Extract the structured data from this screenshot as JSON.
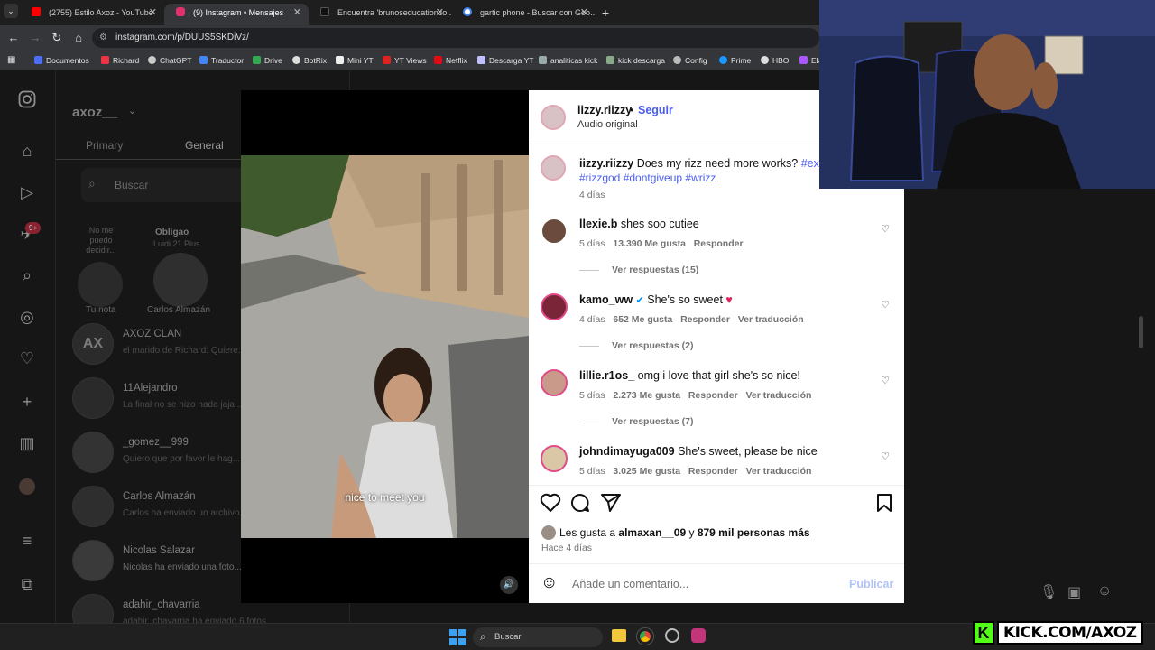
{
  "browser": {
    "tabs": [
      {
        "label": "(2755) Estilo Axoz - YouTube",
        "favicon_color": "#ff0000"
      },
      {
        "label": "(9) Instagram • Mensajes",
        "favicon_color": "#e1306c"
      },
      {
        "label": "Encuentra 'brunoseducationco...",
        "favicon_color": "#111111"
      },
      {
        "label": "gartic phone - Buscar con Goo...",
        "favicon_color": "#4285f4"
      }
    ],
    "url": "instagram.com/p/DUUS5SKDiVz/",
    "bookmarks": [
      "Documentos",
      "Richard",
      "ChatGPT",
      "Traductor",
      "Drive",
      "BotRix",
      "Mini YT",
      "YT Views",
      "Netflix",
      "Descarga YT",
      "analiticas kick",
      "kick descarga",
      "Config",
      "Prime",
      "HBO",
      "Ek"
    ]
  },
  "instagram": {
    "account_name": "axoz__",
    "dm_tabs": [
      "Primary",
      "General"
    ],
    "search_placeholder": "Buscar",
    "notes": [
      {
        "text": "No me puedo decidir...",
        "label": "Tu nota"
      },
      {
        "text": "Obligao",
        "sub": "Luidi 21 Plus",
        "label": "Carlos Almazán"
      }
    ],
    "notification_badge": "9+",
    "conversations": [
      {
        "name": "AXOZ CLAN",
        "snippet": "el marido de Richard: Quiere..."
      },
      {
        "name": "11Alejandro",
        "snippet": "La final no se hizo nada jaja..."
      },
      {
        "name": "_gomez__999",
        "snippet": "Quiero que por favor le hag..."
      },
      {
        "name": "Carlos Almazán",
        "snippet": "Carlos ha enviado un archivo..."
      },
      {
        "name": "Nicolas Salazar",
        "snippet": "Nicolas ha enviado una foto..."
      },
      {
        "name": "adahir_chavarria",
        "snippet": "adahir_chavarria ha enviado 6 fotos"
      }
    ]
  },
  "post": {
    "author": "iizzy.riizzy",
    "follow_label": "Seguir",
    "audio": "Audio original",
    "subtitle": "nice to meet you",
    "caption_user": "iizzy.riizzy",
    "caption_text": "Does my rizz need more works?",
    "caption_tags_line1": "#explor",
    "caption_tags_line2": "#rizzgod #dontgiveup #wrizz",
    "caption_age": "4 días",
    "comments": [
      {
        "user": "llexie.b",
        "text": "shes soo cutiee",
        "age": "5 días",
        "likes": "13.390 Me gusta",
        "reply": "Responder",
        "translate": "",
        "replies": "Ver respuestas (15)"
      },
      {
        "user": "kamo_ww",
        "text": "She's so sweet",
        "age": "4 días",
        "likes": "652 Me gusta",
        "reply": "Responder",
        "translate": "Ver traducción",
        "replies": "Ver respuestas (2)"
      },
      {
        "user": "lillie.r1os_",
        "text": "omg i love that girl she's so nice!",
        "age": "5 días",
        "likes": "2.273 Me gusta",
        "reply": "Responder",
        "translate": "Ver traducción",
        "replies": "Ver respuestas (7)"
      },
      {
        "user": "johndimayuga009",
        "text": "She's sweet, please be nice",
        "age": "5 días",
        "likes": "3.025 Me gusta",
        "reply": "Responder",
        "translate": "Ver traducción",
        "replies": ""
      }
    ],
    "likes_prefix": "Les gusta a",
    "likes_user": "almaxan__09",
    "likes_and": "y",
    "likes_rest": "879 mil personas más",
    "posted": "Hace 4 días",
    "comment_placeholder": "Añade un comentario...",
    "publish_label": "Publicar"
  },
  "taskbar": {
    "search_placeholder": "Buscar"
  },
  "overlay": {
    "kick_text": "KICK.COM/AXOZ"
  },
  "colors": {
    "instagram_blue": "#4a5df0",
    "kick_green": "#53fc18",
    "verified_blue": "#0095f6"
  }
}
